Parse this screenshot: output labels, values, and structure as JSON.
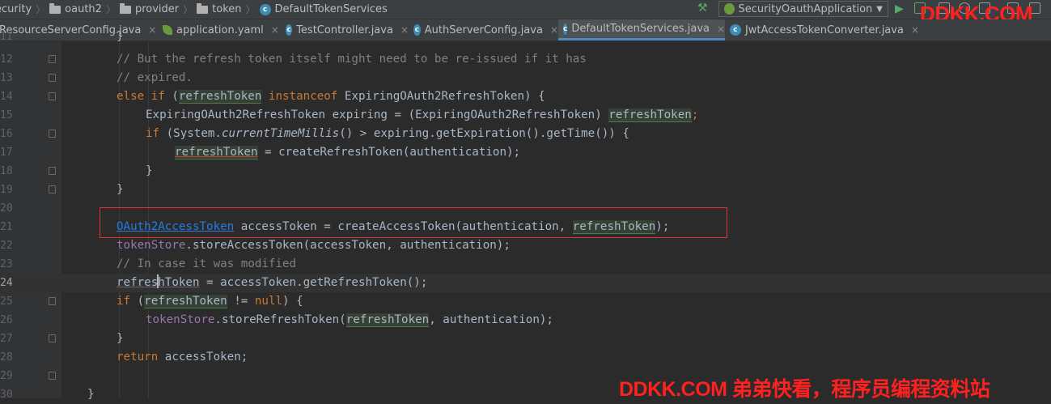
{
  "navbar": {
    "breadcrumbs": [
      {
        "label": "ecurity",
        "icon": "folder-icon"
      },
      {
        "label": "oauth2",
        "icon": "folder-icon"
      },
      {
        "label": "provider",
        "icon": "folder-icon"
      },
      {
        "label": "token",
        "icon": "folder-icon"
      },
      {
        "label": "DefaultTokenServices",
        "icon": "class-icon"
      }
    ],
    "run_config": "SecurityOauthApplication",
    "watermark": "DDKK.COM"
  },
  "tabs": [
    {
      "label": "ResourceServerConfig.java",
      "icon": "class-icon",
      "active": false
    },
    {
      "label": "application.yaml",
      "icon": "yaml-icon",
      "active": false
    },
    {
      "label": "TestController.java",
      "icon": "class-icon",
      "active": false
    },
    {
      "label": "AuthServerConfig.java",
      "icon": "class-icon",
      "active": false
    },
    {
      "label": "DefaultTokenServices.java",
      "icon": "class-icon",
      "active": true
    },
    {
      "label": "JwtAccessTokenConverter.java",
      "icon": "class-icon",
      "active": false
    }
  ],
  "tab_close_glyph": "×",
  "editor": {
    "line_numbers": [
      "11",
      "12",
      "13",
      "14",
      "15",
      "16",
      "17",
      "18",
      "19",
      "20",
      "21",
      "22",
      "23",
      "24",
      "25",
      "26",
      "27",
      "28",
      "29",
      "30"
    ],
    "code": {
      "l12": "// But the refresh token itself might need to be re-issued if it has",
      "l13": "// expired.",
      "else_if": "else if",
      "paren_open": " (",
      "refresh_token": "refreshToken",
      "instanceof": " instanceof",
      "l14_tail": " ExpiringOAuth2RefreshToken) {",
      "l15_head": "ExpiringOAuth2RefreshToken expiring = (ExpiringOAuth2RefreshToken) ",
      "semicolon": ";",
      "if_kw": "if",
      "l16_a": " (System.",
      "current_time": "currentTimeMillis",
      "l16_b": "() > expiring.getExpiration().getTime()) {",
      "l17_tail": " = createRefreshToken(authentication);",
      "close_brace": "}",
      "l21_type": "OAuth2AccessToken",
      "l21_mid": " accessToken = createAccessToken(authentication, ",
      "l21_tail": ");",
      "token_store": "tokenStore",
      "l22_tail": ".storeAccessToken(accessToken, authentication);",
      "l23": "// In case it was modified",
      "refres": "refres",
      "h_token": "hToken",
      "l24_tail": " = accessToken.getRefreshToken();",
      "neq": " != ",
      "null_kw": "null",
      "l25_tail": ") {",
      "l26_mid": ".storeRefreshToken(",
      "l26_tail": ", authentication);",
      "return_kw": "return",
      "l28_tail": " accessToken;"
    }
  },
  "watermark_bottom": "DDKK.COM 弟弟快看，程序员编程资料站"
}
